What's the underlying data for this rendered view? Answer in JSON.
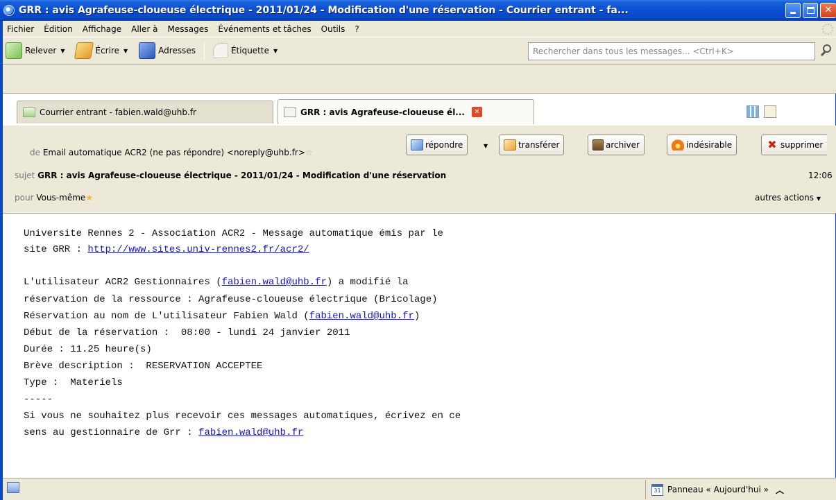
{
  "window": {
    "title": "GRR : avis Agrafeuse-cloueuse électrique - 2011/01/24 - Modification d'une réservation - Courrier entrant - fa..."
  },
  "menu": {
    "items": [
      "Fichier",
      "Édition",
      "Affichage",
      "Aller à",
      "Messages",
      "Événements et tâches",
      "Outils",
      "?"
    ]
  },
  "toolbar": {
    "get_label": "Relever",
    "write_label": "Écrire",
    "addressbook_label": "Adresses",
    "tag_label": "Étiquette",
    "search_placeholder": "Rechercher dans tous les messages... <Ctrl+K>"
  },
  "tabs": [
    {
      "label": "Courrier entrant - fabien.wald@uhb.fr"
    },
    {
      "label": "GRR : avis Agrafeuse-cloueuse él..."
    }
  ],
  "header": {
    "from_label": "de",
    "from_value": "Email automatique ACR2 (ne pas répondre) <noreply@uhb.fr>",
    "subject_label": "sujet",
    "subject_value": "GRR : avis Agrafeuse-cloueuse électrique - 2011/01/24 - Modification d'une réservation",
    "time": "12:06",
    "to_label": "pour",
    "to_value": "Vous-même",
    "more_actions": "autres actions",
    "buttons": {
      "reply": "répondre",
      "forward": "transférer",
      "archive": "archiver",
      "junk": "indésirable",
      "delete": "supprimer"
    }
  },
  "body": {
    "l1": "Universite Rennes 2 - Association ACR2 - Message automatique émis par le",
    "l2_prefix": "site GRR : ",
    "l2_link": "http://www.sites.univ-rennes2.fr/acr2/",
    "l3_prefix": "L'utilisateur ACR2 Gestionnaires (",
    "l3_link": "fabien.wald@uhb.fr",
    "l3_suffix": ") a modifié la",
    "l4": "réservation de la ressource : Agrafeuse-cloueuse électrique (Bricolage)",
    "l5_prefix": "Réservation au nom de L'utilisateur Fabien Wald (",
    "l5_link": "fabien.wald@uhb.fr",
    "l5_suffix": ")",
    "l6": "Début de la réservation :  08:00 - lundi 24 janvier 2011",
    "l7": "Durée : 11.25 heure(s)",
    "l8": "Brève description :  RESERVATION ACCEPTEE",
    "l9": "Type :  Materiels",
    "l10": "-----",
    "l11": "Si vous ne souhaitez plus recevoir ces messages automatiques, écrivez en ce",
    "l12_prefix": "sens au gestionnaire de Grr : ",
    "l12_link": "fabien.wald@uhb.fr"
  },
  "statusbar": {
    "today_panel": "Panneau « Aujourd'hui »",
    "calendar_icon_text": "31"
  }
}
